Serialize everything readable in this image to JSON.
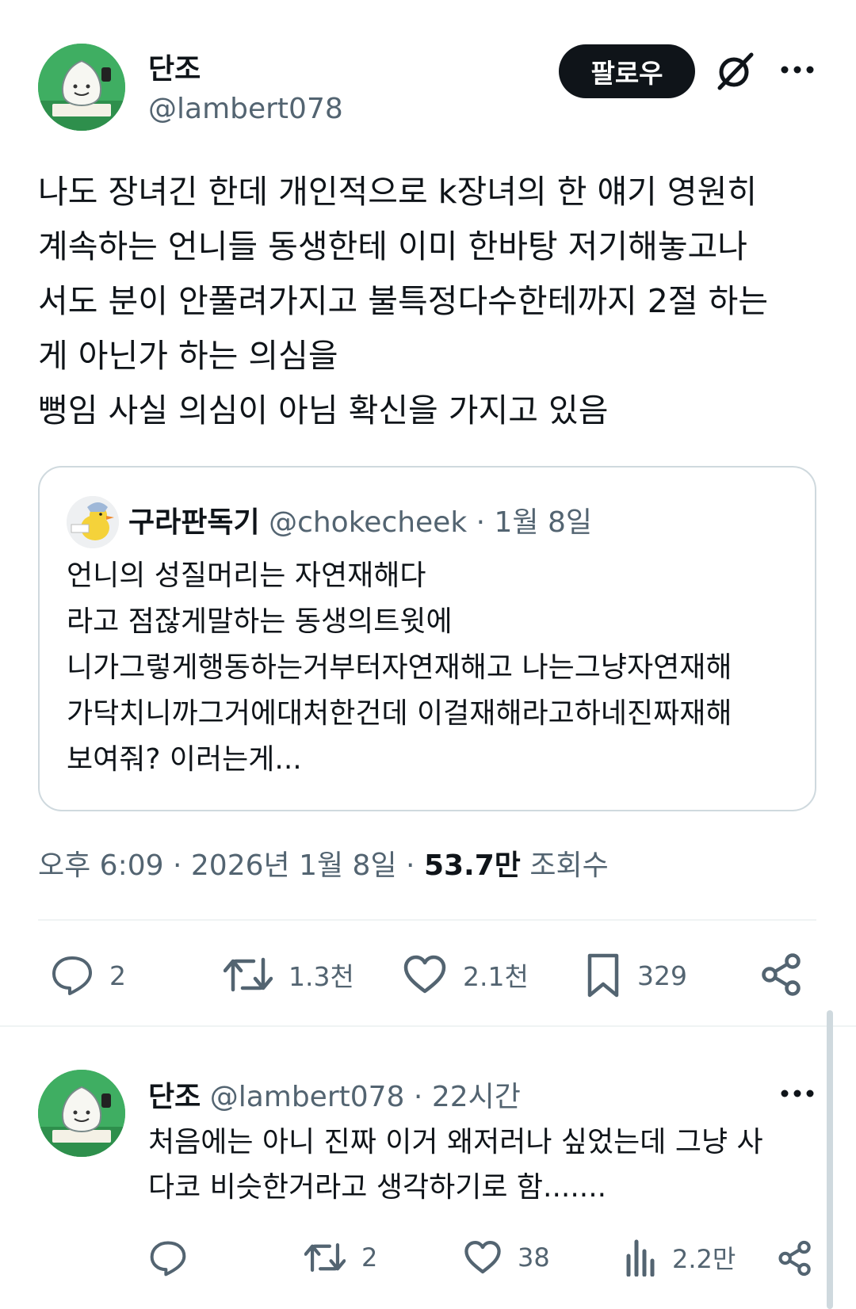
{
  "main_tweet": {
    "author_name": "단조",
    "author_handle": "@lambert078",
    "follow_label": "팔로우",
    "text": "나도 장녀긴 한데 개인적으로 k장녀의 한 얘기 영원히\n계속하는 언니들 동생한테 이미 한바탕 저기해놓고나\n서도 분이 안풀려가지고 불특정다수한테까지 2절 하는\n게 아닌가 하는 의심을\n뻥임 사실 의심이 아님 확신을 가지고 있음",
    "meta": {
      "time": "오후 6:09",
      "date": "2026년 1월 8일",
      "views_count": "53.7만",
      "views_label": "조회수",
      "separator": "·"
    },
    "actions": {
      "replies": "2",
      "retweets": "1.3천",
      "likes": "2.1천",
      "bookmarks": "329"
    }
  },
  "quoted_tweet": {
    "author_name": "구라판독기",
    "author_handle": "@chokecheek",
    "separator": "·",
    "date": "1월 8일",
    "text": "언니의 성질머리는 자연재해다\n라고 점잖게말하는 동생의트윗에\n니가그렇게행동하는거부터자연재해고 나는그냥자연재해\n가닥치니까그거에대처한건데 이걸재해라고하네진짜재해\n보여줘? 이러는게..."
  },
  "reply_tweet": {
    "author_name": "단조",
    "author_handle": "@lambert078",
    "separator": "·",
    "time": "22시간",
    "text": "처음에는 아니 진짜 이거 왜저러나 싶었는데 그냥 사\n다코 비슷한거라고 생각하기로 함.......",
    "actions": {
      "replies": "",
      "retweets": "2",
      "likes": "38",
      "views": "2.2만"
    }
  },
  "colors": {
    "text": "#0f1419",
    "muted": "#536471",
    "border": "#cfd9de",
    "button_bg": "#0f1419"
  }
}
